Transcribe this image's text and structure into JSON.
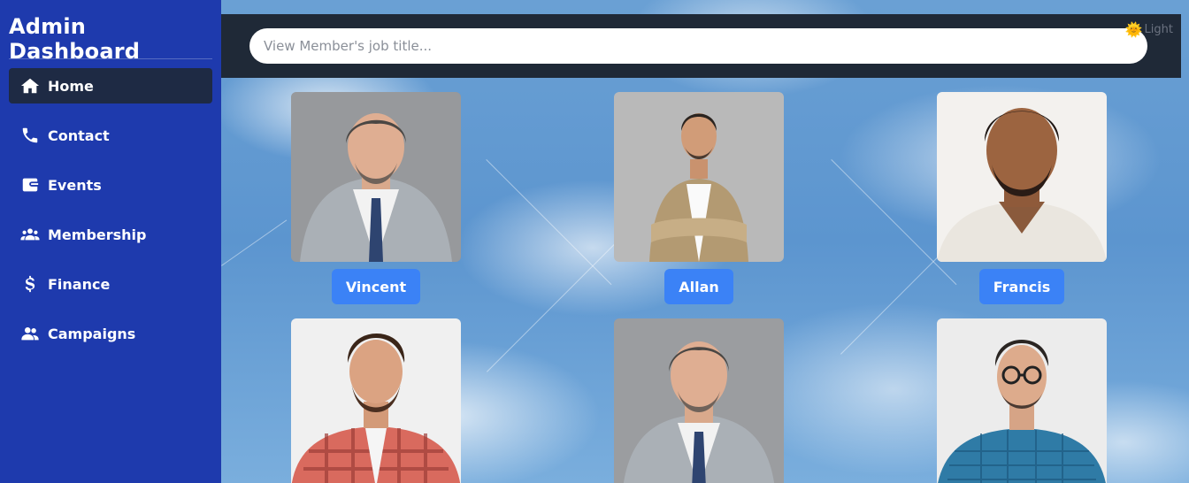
{
  "sidebar": {
    "title": "Admin Dashboard",
    "items": [
      {
        "label": "Home",
        "icon": "home-icon",
        "active": true
      },
      {
        "label": "Contact",
        "icon": "phone-icon",
        "active": false
      },
      {
        "label": "Events",
        "icon": "wallet-icon",
        "active": false
      },
      {
        "label": "Membership",
        "icon": "users-icon",
        "active": false
      },
      {
        "label": "Finance",
        "icon": "dollar-icon",
        "active": false
      },
      {
        "label": "Campaigns",
        "icon": "user-group-icon",
        "active": false
      }
    ]
  },
  "topbar": {
    "search_placeholder": "View Member's job title...",
    "search_value": "",
    "theme_icon": "sun-icon",
    "theme_label": "Light"
  },
  "members": [
    {
      "name": "Vincent"
    },
    {
      "name": "Allan"
    },
    {
      "name": "Francis"
    },
    {
      "name": ""
    },
    {
      "name": ""
    },
    {
      "name": ""
    }
  ],
  "colors": {
    "sidebar": "#1e3aad",
    "topbar": "#1f2937",
    "accent": "#3b82f6",
    "active_nav": "#1e2a44"
  }
}
